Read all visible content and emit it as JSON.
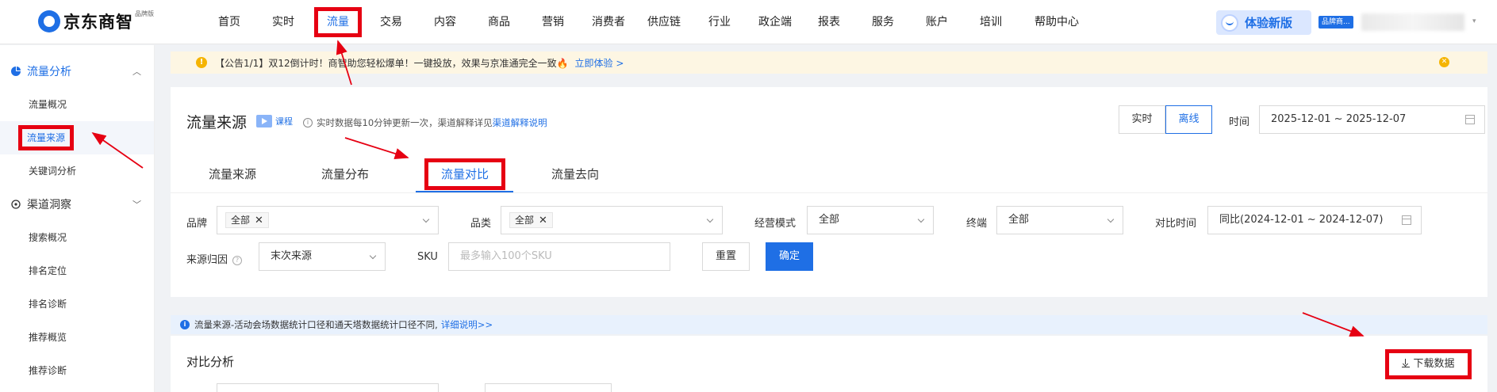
{
  "logo": {
    "text": "京东商智",
    "sub": "品牌版"
  },
  "nav": {
    "items": [
      "首页",
      "实时",
      "流量",
      "交易",
      "内容",
      "商品",
      "营销",
      "消费者",
      "供应链",
      "行业",
      "政企端",
      "报表",
      "服务",
      "账户",
      "培训",
      "帮助中心"
    ]
  },
  "header": {
    "experience_label": "体验新版",
    "brand_badge": "品牌商..."
  },
  "sidebar": {
    "groups": [
      {
        "label": "流量分析",
        "items": [
          "流量概况",
          "流量来源",
          "关键词分析"
        ]
      },
      {
        "label": "渠道洞察",
        "items": [
          "搜索概况",
          "排名定位",
          "排名诊断",
          "推荐概览",
          "推荐诊断"
        ]
      }
    ]
  },
  "notice": {
    "text": "【公告1/1】双12倒计时！商智助您轻松爆单！一键投放，效果与京准通完全一致🔥",
    "link": "立即体验 >"
  },
  "page": {
    "title": "流量来源",
    "course": "课程",
    "info": "实时数据每10分钟更新一次，渠道解释详见",
    "info_link": "渠道解释说明",
    "seg": [
      "实时",
      "离线"
    ],
    "time_label": "时间",
    "date_range": "2025-12-01 ~ 2025-12-07"
  },
  "tabs": [
    "流量来源",
    "流量分布",
    "流量对比",
    "流量去向"
  ],
  "filters": {
    "brand_label": "品牌",
    "brand_tag": "全部",
    "category_label": "品类",
    "category_tag": "全部",
    "mode_label": "经营模式",
    "mode_value": "全部",
    "terminal_label": "终端",
    "terminal_value": "全部",
    "compare_label": "对比时间",
    "compare_value": "同比(2024-12-01 ~ 2024-12-07)",
    "attribution_label": "来源归因",
    "attribution_value": "末次来源",
    "sku_label": "SKU",
    "sku_placeholder": "最多输入100个SKU",
    "reset": "重置",
    "confirm": "确定"
  },
  "info_bar": {
    "text": "流量来源-活动会场数据统计口径和通天塔数据统计口径不同,",
    "link": "详细说明>>"
  },
  "compare": {
    "title": "对比分析",
    "download": "下载数据"
  },
  "colors": {
    "accent": "#1f6fe5",
    "highlight": "#e60012",
    "notice_bg": "#fdf6e3"
  }
}
